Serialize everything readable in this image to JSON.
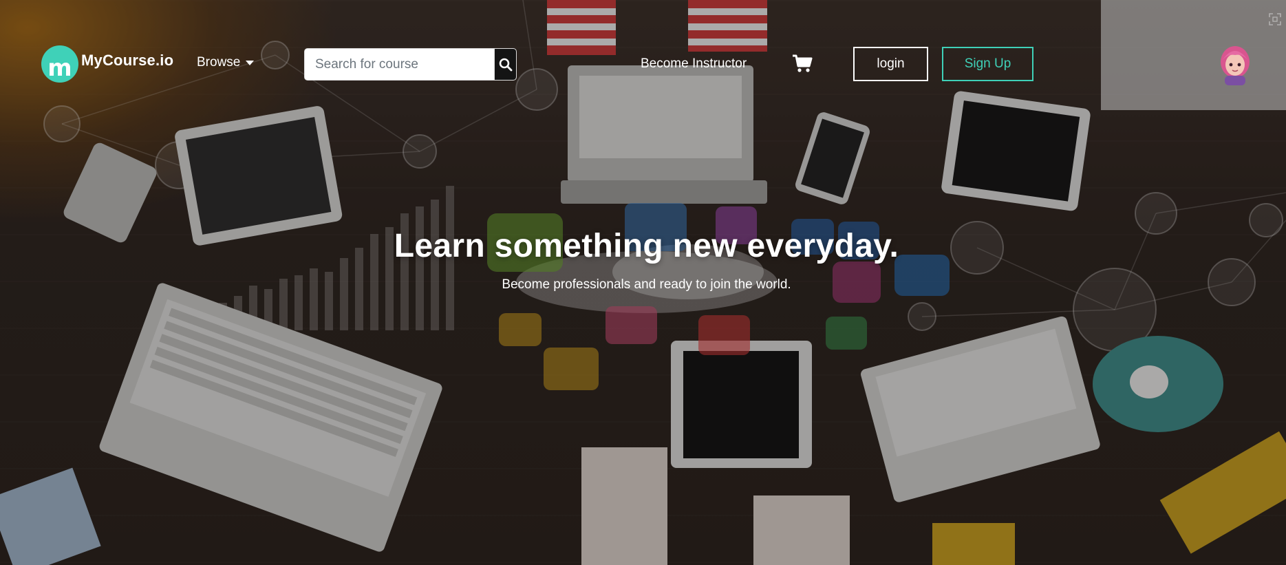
{
  "navbar": {
    "logo_letter": "m",
    "logo_text": "MyCourse.io",
    "browse_label": "Browse",
    "search": {
      "placeholder": "Search for course",
      "value": ""
    },
    "become_instructor_label": "Become Instructor",
    "login_label": "login",
    "signup_label": "Sign Up"
  },
  "hero": {
    "title": "Learn something new everyday.",
    "subtitle": "Become professionals and ready to join the world."
  },
  "colors": {
    "accent": "#3fd1b8",
    "search_button": "#141414",
    "background": "#2d241f"
  },
  "icons": [
    "search-icon",
    "cart-icon",
    "caret-down-icon",
    "user-avatar",
    "fullscreen-icon"
  ]
}
